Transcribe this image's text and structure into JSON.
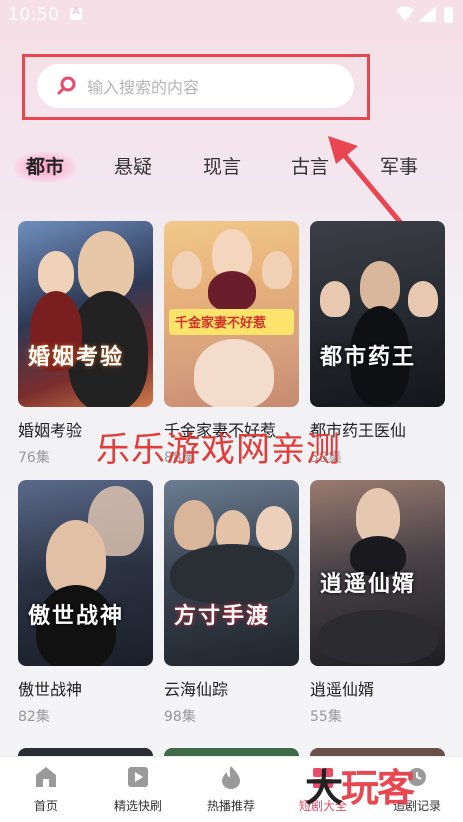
{
  "status_bar": {
    "time": "10:50"
  },
  "search": {
    "placeholder": "输入搜索的内容"
  },
  "tabs": [
    {
      "label": "都市",
      "active": true
    },
    {
      "label": "悬疑",
      "active": false
    },
    {
      "label": "现言",
      "active": false
    },
    {
      "label": "古言",
      "active": false
    },
    {
      "label": "军事",
      "active": false
    }
  ],
  "dramas": [
    {
      "title": "婚姻考验",
      "episodes": "76集",
      "poster_text": "婚姻考验"
    },
    {
      "title": "千金家妻不好惹",
      "episodes": "88集",
      "poster_text": "千金家妻不好惹"
    },
    {
      "title": "都市药王医仙",
      "episodes": "58集",
      "poster_text": "都市药王"
    },
    {
      "title": "傲世战神",
      "episodes": "82集",
      "poster_text": "傲世战神"
    },
    {
      "title": "云海仙踪",
      "episodes": "98集",
      "poster_text": "方寸手渡"
    },
    {
      "title": "逍遥仙婿",
      "episodes": "55集",
      "poster_text": "逍遥仙婿"
    }
  ],
  "watermark": "乐乐游戏网亲测",
  "bottom_nav": [
    {
      "label": "首页",
      "icon": "home-icon",
      "active": false
    },
    {
      "label": "精选快刷",
      "icon": "play-icon",
      "active": false
    },
    {
      "label": "热播推荐",
      "icon": "fire-icon",
      "active": false
    },
    {
      "label": "短剧大全",
      "icon": "grid-icon",
      "active": true
    },
    {
      "label": "追剧记录",
      "icon": "history-icon",
      "active": false
    }
  ],
  "logo_watermark": {
    "part1": "大",
    "part2": "玩客"
  },
  "colors": {
    "accent": "#e94b6b",
    "highlight_box": "#e84651",
    "watermark": "#e23b3b"
  }
}
